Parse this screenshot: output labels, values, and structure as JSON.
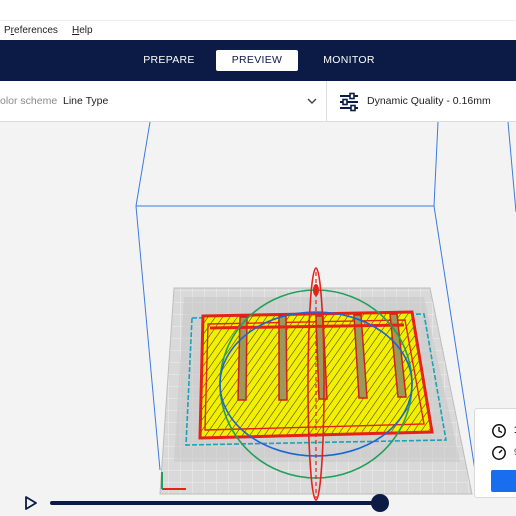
{
  "menu": {
    "items": [
      {
        "label": "Preferences",
        "mnemonic": "r"
      },
      {
        "label": "Help",
        "mnemonic": "H"
      }
    ]
  },
  "stages": {
    "tabs": [
      {
        "label": "PREPARE",
        "active": false
      },
      {
        "label": "PREVIEW",
        "active": true
      },
      {
        "label": "MONITOR",
        "active": false
      }
    ]
  },
  "view_options": {
    "color_scheme_label": "olor scheme",
    "color_scheme_value": "Line Type",
    "chevron_icon": "chevron-down-icon"
  },
  "print_profile": {
    "icon": "sliders-icon",
    "label": "Dynamic Quality - 0.16mm"
  },
  "estimate": {
    "time_icon": "clock-icon",
    "time_value": "1",
    "material_icon": "gauge-icon",
    "material_value": "9"
  },
  "simulation": {
    "play_icon": "play-icon",
    "progress": 1.0
  },
  "colors": {
    "stage_bar": "#0b1b45",
    "accent_blue": "#196ef0",
    "infill_yellow": "#f2f000",
    "wall_red": "#e8201a",
    "skirt_cyan": "#19a3b8",
    "build_volume_blue": "#3a7be0"
  }
}
